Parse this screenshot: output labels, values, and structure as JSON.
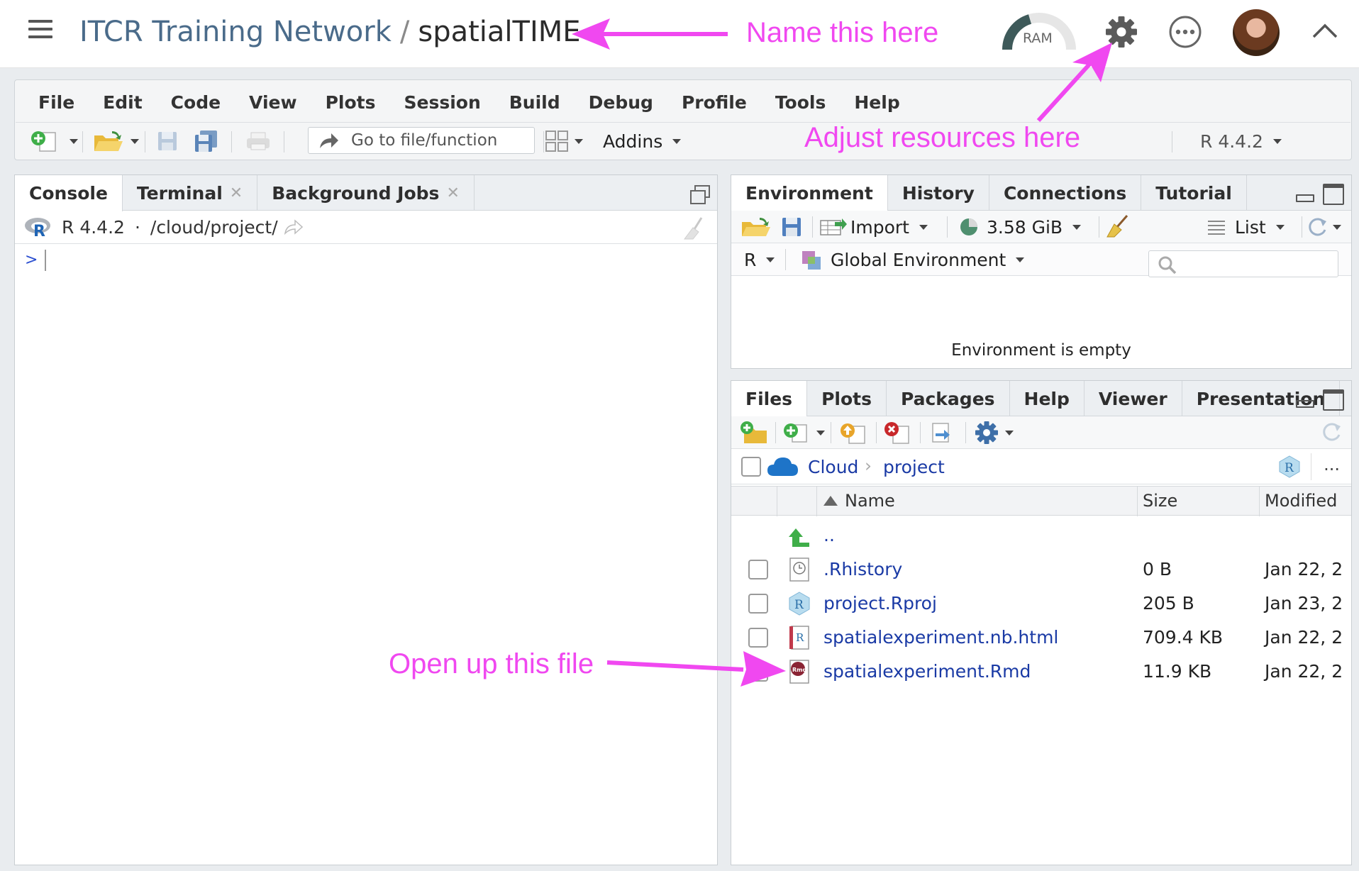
{
  "topbar": {
    "workspace": "ITCR Training Network",
    "separator": "/",
    "project": "spatialTIME",
    "ram_label": "RAM"
  },
  "menu": [
    "File",
    "Edit",
    "Code",
    "View",
    "Plots",
    "Session",
    "Build",
    "Debug",
    "Profile",
    "Tools",
    "Help"
  ],
  "toolbar": {
    "goto_placeholder": "Go to file/function",
    "addins_label": "Addins",
    "r_version": "R 4.4.2"
  },
  "console": {
    "tabs": [
      "Console",
      "Terminal",
      "Background Jobs"
    ],
    "r_version": "R 4.4.2",
    "dot": "·",
    "path": "/cloud/project/",
    "prompt": ">"
  },
  "environment": {
    "tabs": [
      "Environment",
      "History",
      "Connections",
      "Tutorial"
    ],
    "import_label": "Import",
    "memory_label": "3.58 GiB",
    "list_label": "List",
    "language": "R",
    "scope": "Global Environment",
    "empty_message": "Environment is empty"
  },
  "files": {
    "tabs": [
      "Files",
      "Plots",
      "Packages",
      "Help",
      "Viewer",
      "Presentation"
    ],
    "breadcrumb": [
      "Cloud",
      "project"
    ],
    "more": "...",
    "columns": {
      "name": "Name",
      "size": "Size",
      "modified": "Modified"
    },
    "parent": "..",
    "rows": [
      {
        "name": ".Rhistory",
        "size": "0 B",
        "modified": "Jan 22, 2",
        "icon": "history-file-icon"
      },
      {
        "name": "project.Rproj",
        "size": "205 B",
        "modified": "Jan 23, 2",
        "icon": "rproj-file-icon"
      },
      {
        "name": "spatialexperiment.nb.html",
        "size": "709.4 KB",
        "modified": "Jan 22, 2",
        "icon": "notebook-file-icon"
      },
      {
        "name": "spatialexperiment.Rmd",
        "size": "11.9 KB",
        "modified": "Jan 22, 2",
        "icon": "rmd-file-icon"
      }
    ]
  },
  "annotations": {
    "name_here": "Name this here",
    "resources": "Adjust resources here",
    "open_file": "Open up this file",
    "color": "#f048f0"
  }
}
